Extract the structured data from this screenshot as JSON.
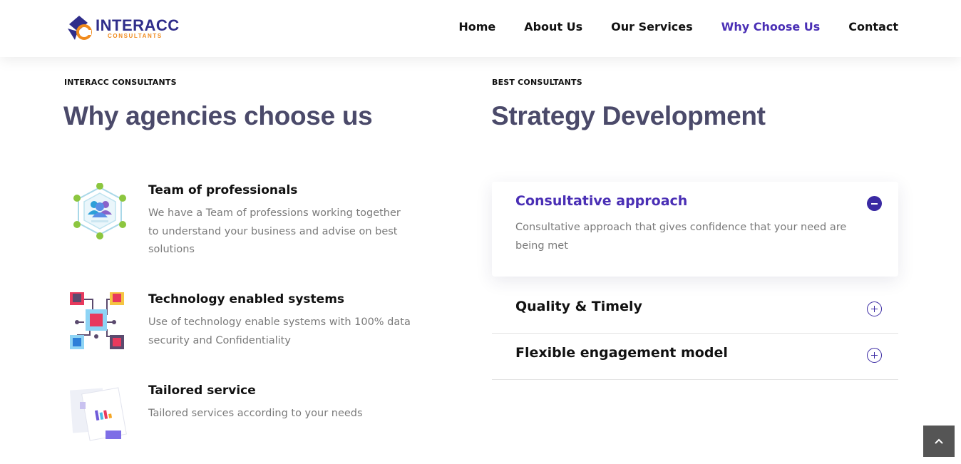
{
  "header": {
    "logo": {
      "name": "INTERACC",
      "sub": "CONSULTANTS"
    },
    "nav": [
      {
        "label": "Home",
        "active": false
      },
      {
        "label": "About Us",
        "active": false
      },
      {
        "label": "Our Services",
        "active": false
      },
      {
        "label": "Why Choose Us",
        "active": true
      },
      {
        "label": "Contact",
        "active": false
      }
    ]
  },
  "left": {
    "eyebrow": "INTERACC CONSULTANTS",
    "heading": "Why agencies choose us",
    "features": [
      {
        "icon": "team-network-icon",
        "title": "Team of professionals",
        "text": "We have a Team of professions working together to understand your business and advise on best solutions"
      },
      {
        "icon": "circuit-chip-icon",
        "title": "Technology enabled systems",
        "text": "Use of technology enable systems with 100% data security and Confidentiality"
      },
      {
        "icon": "report-document-icon",
        "title": "Tailored service",
        "text": "Tailored services according to your needs"
      }
    ]
  },
  "right": {
    "eyebrow": "BEST CONSULTANTS",
    "heading": "Strategy Development",
    "accordion": [
      {
        "title": "Consultative approach",
        "text": "Consultative approach that gives confidence that your need are being met",
        "open": true
      },
      {
        "title": "Quality & Timely",
        "open": false
      },
      {
        "title": "Flexible engagement model",
        "open": false
      }
    ]
  },
  "colors": {
    "accent": "#4a2fb5",
    "heading": "#4b4a6a",
    "body_text": "#7a7a7a",
    "logo_orange": "#f08a1c"
  }
}
